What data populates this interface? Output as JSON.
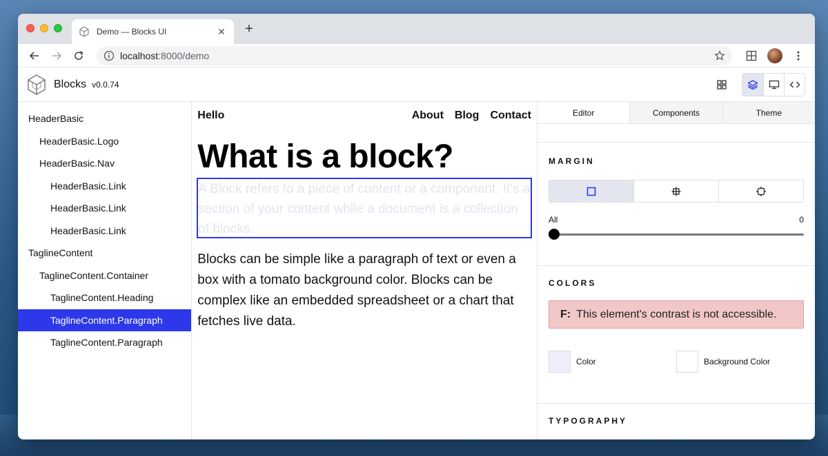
{
  "browser": {
    "tab_title": "Demo — Blocks UI",
    "url_host": "localhost",
    "url_path": ":8000/demo"
  },
  "app": {
    "brand": "Blocks",
    "version": "v0.0.74"
  },
  "tree": {
    "items": [
      {
        "label": "HeaderBasic",
        "depth": 0,
        "selected": false
      },
      {
        "label": "HeaderBasic.Logo",
        "depth": 1,
        "selected": false
      },
      {
        "label": "HeaderBasic.Nav",
        "depth": 1,
        "selected": false
      },
      {
        "label": "HeaderBasic.Link",
        "depth": 2,
        "selected": false
      },
      {
        "label": "HeaderBasic.Link",
        "depth": 2,
        "selected": false
      },
      {
        "label": "HeaderBasic.Link",
        "depth": 2,
        "selected": false
      },
      {
        "label": "TaglineContent",
        "depth": 0,
        "selected": false
      },
      {
        "label": "TaglineContent.Container",
        "depth": 1,
        "selected": false
      },
      {
        "label": "TaglineContent.Heading",
        "depth": 2,
        "selected": false
      },
      {
        "label": "TaglineContent.Paragraph",
        "depth": 2,
        "selected": true
      },
      {
        "label": "TaglineContent.Paragraph",
        "depth": 2,
        "selected": false
      }
    ]
  },
  "preview": {
    "logo_text": "Hello",
    "nav_links": [
      "About",
      "Blog",
      "Contact"
    ],
    "heading": "What is a block?",
    "paragraph_selected": "A Block refers to a piece of content or a component. It's a section of your content while a document is a collection of blocks.",
    "paragraph_2": "Blocks can be simple like a paragraph of text or even a box with a tomato background color. Blocks can be complex like an embedded spreadsheet or a chart that fetches live data."
  },
  "panel": {
    "tabs": [
      "Editor",
      "Components",
      "Theme"
    ],
    "margin": {
      "title": "MARGIN",
      "slider_label": "All",
      "slider_value": "0"
    },
    "colors": {
      "title": "COLORS",
      "alert_prefix": "F:",
      "alert_text": "This element's contrast is not accessible.",
      "color_label": "Color",
      "color_value": "#eeeefb",
      "bg_label": "Background Color",
      "bg_value": "#ffffff"
    },
    "typography": {
      "title": "TYPOGRAPHY"
    }
  },
  "colors": {
    "accent": "#2c38ea",
    "alert_bg": "#f1c7c7"
  }
}
